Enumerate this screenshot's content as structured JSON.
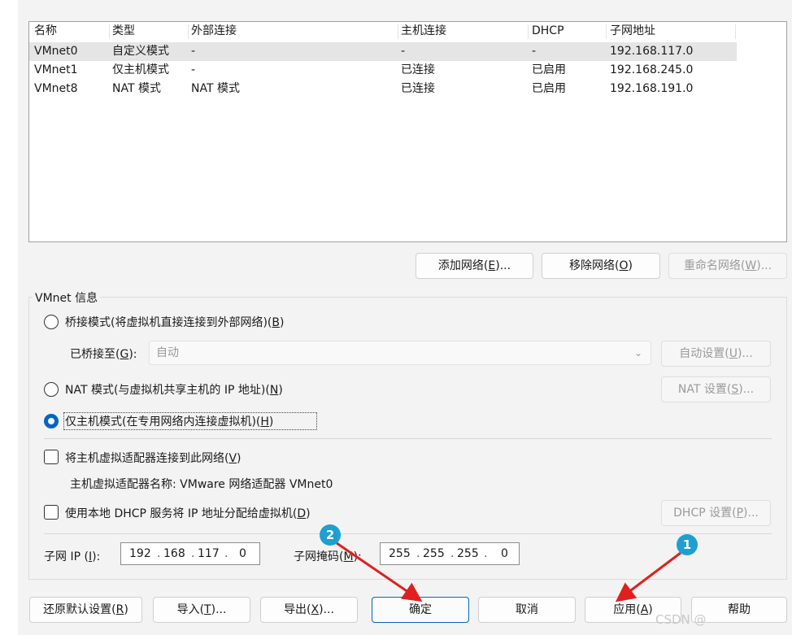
{
  "table": {
    "headers": [
      "名称",
      "类型",
      "外部连接",
      "主机连接",
      "DHCP",
      "子网地址"
    ],
    "rows": [
      [
        "VMnet0",
        "自定义模式",
        "-",
        "-",
        "-",
        "192.168.117.0"
      ],
      [
        "VMnet1",
        "仅主机模式",
        "-",
        "已连接",
        "已启用",
        "192.168.245.0"
      ],
      [
        "VMnet8",
        "NAT 模式",
        "NAT 模式",
        "已连接",
        "已启用",
        "192.168.191.0"
      ]
    ]
  },
  "network_buttons": {
    "add": {
      "pre": "添加网络(",
      "key": "E",
      "post": ")..."
    },
    "remove": {
      "pre": "移除网络(",
      "key": "O",
      "post": ")"
    },
    "rename": {
      "pre": "重命名网络(",
      "key": "W",
      "post": ")..."
    }
  },
  "vmnet_info": {
    "title": "VMnet 信息",
    "bridged": {
      "pre": "桥接模式(将虚拟机直接连接到外部网络)(",
      "key": "B",
      "post": ")"
    },
    "bridged_to": {
      "pre": "已桥接至(",
      "key": "G",
      "post": "):"
    },
    "bridged_combo_value": "自动",
    "auto_settings": {
      "pre": "自动设置(",
      "key": "U",
      "post": ")..."
    },
    "nat": {
      "pre": "NAT 模式(与虚拟机共享主机的 IP 地址)(",
      "key": "N",
      "post": ")"
    },
    "nat_settings": {
      "pre": "NAT 设置(",
      "key": "S",
      "post": ")..."
    },
    "host_only": {
      "pre": "仅主机模式(在专用网络内连接虚拟机)(",
      "key": "H",
      "post": ")"
    },
    "connect_adapter": {
      "pre": "将主机虚拟适配器连接到此网络(",
      "key": "V",
      "post": ")"
    },
    "adapter_name_text": "主机虚拟适配器名称: VMware 网络适配器 VMnet0",
    "dhcp_service": {
      "pre": "使用本地 DHCP 服务将 IP 地址分配给虚拟机(",
      "key": "D",
      "post": ")"
    },
    "dhcp_settings": {
      "pre": "DHCP 设置(",
      "key": "P",
      "post": ")..."
    },
    "subnet_ip_label": {
      "pre": "子网 IP (",
      "key": "I",
      "post": "):"
    },
    "subnet_ip": [
      "192",
      "168",
      "117",
      "0"
    ],
    "subnet_mask_label": {
      "pre": "子网掩码(",
      "key": "M",
      "post": "):"
    },
    "subnet_mask": [
      "255",
      "255",
      "255",
      "0"
    ],
    "selected_mode": "host_only"
  },
  "footer_buttons": {
    "restore": {
      "pre": "还原默认设置(",
      "key": "R",
      "post": ")"
    },
    "import": {
      "pre": "导入(",
      "key": "T",
      "post": ")..."
    },
    "export": {
      "pre": "导出(",
      "key": "X",
      "post": ")..."
    },
    "ok": "确定",
    "cancel": "取消",
    "apply": {
      "pre": "应用(",
      "key": "A",
      "post": ")"
    },
    "help": "帮助"
  },
  "annotations": {
    "badge1": "1",
    "badge2": "2",
    "arrow_color": "#e0201e",
    "badge_color": "#1e9fd0"
  },
  "watermark": "CSDN @"
}
